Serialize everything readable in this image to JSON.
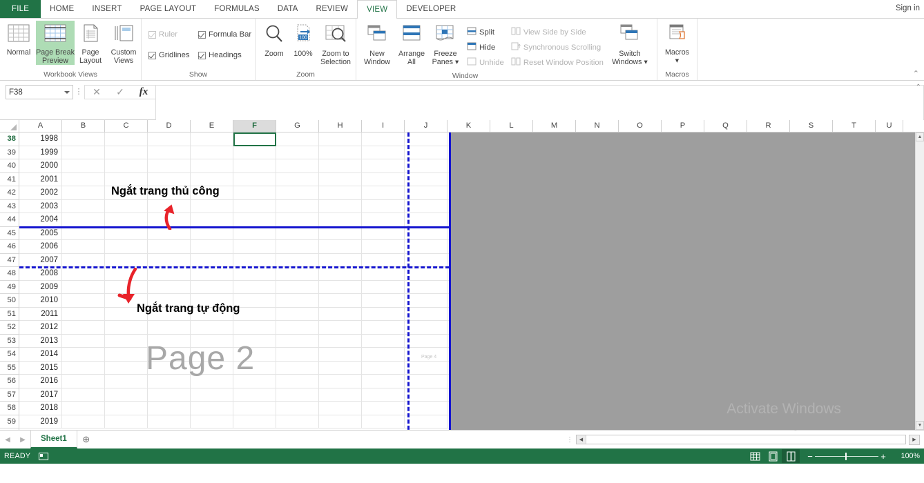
{
  "app": {
    "signin": "Sign in"
  },
  "tabs": [
    {
      "label": "FILE",
      "kind": "file"
    },
    {
      "label": "HOME",
      "kind": "normal"
    },
    {
      "label": "INSERT",
      "kind": "normal"
    },
    {
      "label": "PAGE LAYOUT",
      "kind": "normal"
    },
    {
      "label": "FORMULAS",
      "kind": "normal"
    },
    {
      "label": "DATA",
      "kind": "normal"
    },
    {
      "label": "REVIEW",
      "kind": "normal"
    },
    {
      "label": "VIEW",
      "kind": "active"
    },
    {
      "label": "DEVELOPER",
      "kind": "normal"
    }
  ],
  "ribbon": {
    "collapse_glyph": "⌃",
    "groups": [
      {
        "title": "Workbook Views",
        "buttons": [
          {
            "label": "Normal",
            "icon": "grid-icon",
            "selected": false
          },
          {
            "label": "Page Break\nPreview",
            "icon": "page-break-preview-icon",
            "selected": true
          },
          {
            "label": "Page\nLayout",
            "icon": "page-layout-icon",
            "selected": false
          },
          {
            "label": "Custom\nViews",
            "icon": "custom-views-icon",
            "selected": false
          }
        ]
      },
      {
        "title": "Show",
        "checks": [
          {
            "label": "Ruler",
            "checked": true,
            "disabled": true
          },
          {
            "label": "Formula Bar",
            "checked": true,
            "disabled": false
          },
          {
            "label": "Gridlines",
            "checked": true,
            "disabled": false
          },
          {
            "label": "Headings",
            "checked": true,
            "disabled": false
          }
        ]
      },
      {
        "title": "Zoom",
        "buttons": [
          {
            "label": "Zoom",
            "icon": "magnifier-icon",
            "selected": false
          },
          {
            "label": "100%",
            "icon": "zoom-100-icon",
            "selected": false
          },
          {
            "label": "Zoom to\nSelection",
            "icon": "zoom-to-selection-icon",
            "selected": false
          }
        ]
      },
      {
        "title": "Window",
        "buttons": [
          {
            "label": "New\nWindow",
            "icon": "new-window-icon",
            "selected": false
          },
          {
            "label": "Arrange\nAll",
            "icon": "arrange-all-icon",
            "selected": false
          },
          {
            "label": "Freeze\nPanes ▾",
            "icon": "freeze-panes-icon",
            "selected": false
          }
        ],
        "commands": [
          {
            "label": "Split",
            "icon": "split-icon",
            "disabled": false
          },
          {
            "label": "Hide",
            "icon": "hide-icon",
            "disabled": false
          },
          {
            "label": "Unhide",
            "icon": "unhide-icon",
            "disabled": true
          },
          {
            "label": "View Side by Side",
            "icon": "view-side-by-side-icon",
            "disabled": true
          },
          {
            "label": "Synchronous Scrolling",
            "icon": "synchronous-scrolling-icon",
            "disabled": true
          },
          {
            "label": "Reset Window Position",
            "icon": "reset-window-position-icon",
            "disabled": true
          }
        ]
      },
      {
        "title": "Macros",
        "buttons": [
          {
            "label": "Macros\n▾",
            "icon": "macros-icon",
            "selected": false
          }
        ]
      }
    ]
  },
  "formula_bar": {
    "name_box_value": "F38",
    "name_box_placeholder": "Name Box",
    "cancel_glyph": "✕",
    "enter_glyph": "✓",
    "fx_glyph": "fx",
    "formula_value": "",
    "formula_placeholder": "",
    "expand_glyph": "⌃",
    "dots_glyph": "⋮"
  },
  "grid": {
    "columns": [
      "A",
      "B",
      "C",
      "D",
      "E",
      "F",
      "G",
      "H",
      "I",
      "J",
      "K",
      "L",
      "M",
      "N",
      "O",
      "P",
      "Q",
      "R",
      "S",
      "T",
      "U"
    ],
    "selected_column": "F",
    "selected_row": 38,
    "rows": [
      {
        "num": 38,
        "a": "1998"
      },
      {
        "num": 39,
        "a": "1999"
      },
      {
        "num": 40,
        "a": "2000"
      },
      {
        "num": 41,
        "a": "2001"
      },
      {
        "num": 42,
        "a": "2002"
      },
      {
        "num": 43,
        "a": "2003"
      },
      {
        "num": 44,
        "a": "2004"
      },
      {
        "num": 45,
        "a": "2005"
      },
      {
        "num": 46,
        "a": "2006"
      },
      {
        "num": 47,
        "a": "2007"
      },
      {
        "num": 48,
        "a": "2008"
      },
      {
        "num": 49,
        "a": "2009"
      },
      {
        "num": 50,
        "a": "2010"
      },
      {
        "num": 51,
        "a": "2011"
      },
      {
        "num": 52,
        "a": "2012"
      },
      {
        "num": 53,
        "a": "2013"
      },
      {
        "num": 54,
        "a": "2014"
      },
      {
        "num": 55,
        "a": "2015"
      },
      {
        "num": 56,
        "a": "2016"
      },
      {
        "num": 57,
        "a": "2017"
      },
      {
        "num": 58,
        "a": "2018"
      },
      {
        "num": 59,
        "a": "2019"
      }
    ],
    "page_labels": [
      {
        "text": "Page 2",
        "size": "large"
      },
      {
        "text": "Page 4",
        "size": "small"
      }
    ],
    "page_break_color": "#1414cf",
    "annotations": [
      {
        "text": "Ngắt trang thủ công"
      },
      {
        "text": "Ngắt trang tự động"
      }
    ],
    "scroll_up_glyph": "▲",
    "scroll_down_glyph": "▼"
  },
  "watermark": {
    "title": "Activate Windows",
    "subtitle": "Go to Settings to activate Windows."
  },
  "sheetbar": {
    "prev_glyph": "◀",
    "next_glyph": "▶",
    "sheets": [
      {
        "label": "Sheet1",
        "active": true
      }
    ],
    "new_sheet_glyph": "⊕",
    "hsplit_dots": "⋮",
    "hscroll_left_glyph": "◀",
    "hscroll_right_glyph": "▶"
  },
  "status": {
    "mode": "READY",
    "record_macro_icon": "record-macro-icon",
    "views": [
      {
        "name": "normal-view-button",
        "glyph": "▦",
        "active": false
      },
      {
        "name": "page-layout-view-button",
        "glyph": "▤",
        "active": false
      },
      {
        "name": "page-break-preview-button",
        "glyph": "⧉",
        "active": true
      }
    ],
    "zoom_out_glyph": "−",
    "zoom_in_glyph": "+",
    "zoom_value": "100%"
  }
}
